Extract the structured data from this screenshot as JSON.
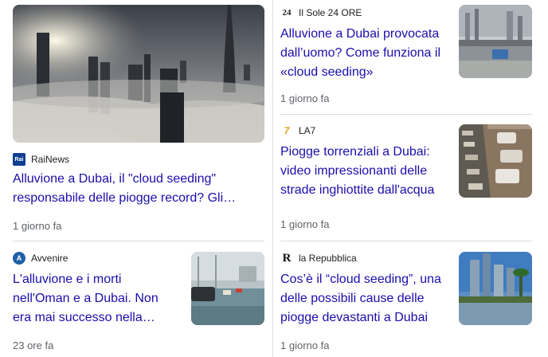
{
  "articles": [
    {
      "source": "RaiNews",
      "logo_text": "Rai",
      "title_lines": [
        "Alluvione a Dubai, il \"cloud seeding\"",
        "responsabile delle piogge record? Gli…"
      ],
      "time": "1 giorno fa",
      "image": "dubai-skyline-fog-image"
    },
    {
      "source": "Il Sole 24 ORE",
      "logo_text": "24",
      "title_lines": [
        "Alluvione a Dubai provocata",
        "dall’uomo? Come funziona il",
        "«cloud seeding»"
      ],
      "time": "1 giorno fa",
      "image": "dubai-flooded-highway-image"
    },
    {
      "source": "LA7",
      "logo_text": "7",
      "title_lines": [
        "Piogge torrenziali a Dubai:",
        "video impressionanti delle",
        "strade inghiottite dall'acqua"
      ],
      "time": "1 giorno fa",
      "image": "flooded-street-cars-image"
    },
    {
      "source": "Avvenire",
      "logo_text": "A",
      "title_lines": [
        "L'alluvione e i morti",
        "nell'Oman e a Dubai. Non",
        "era mai successo nella…"
      ],
      "time": "23 ore fa",
      "image": "flooded-road-rain-image"
    },
    {
      "source": "la Repubblica",
      "logo_text": "R",
      "title_lines": [
        "Cos’è il “cloud seeding”, una",
        "delle possibili cause delle",
        "piogge devastanti a Dubai"
      ],
      "time": "1 giorno fa",
      "image": "dubai-marina-flood-image"
    }
  ],
  "colors": {
    "link": "#1a0dab",
    "meta": "#5f6368",
    "divider": "#dadce0"
  }
}
